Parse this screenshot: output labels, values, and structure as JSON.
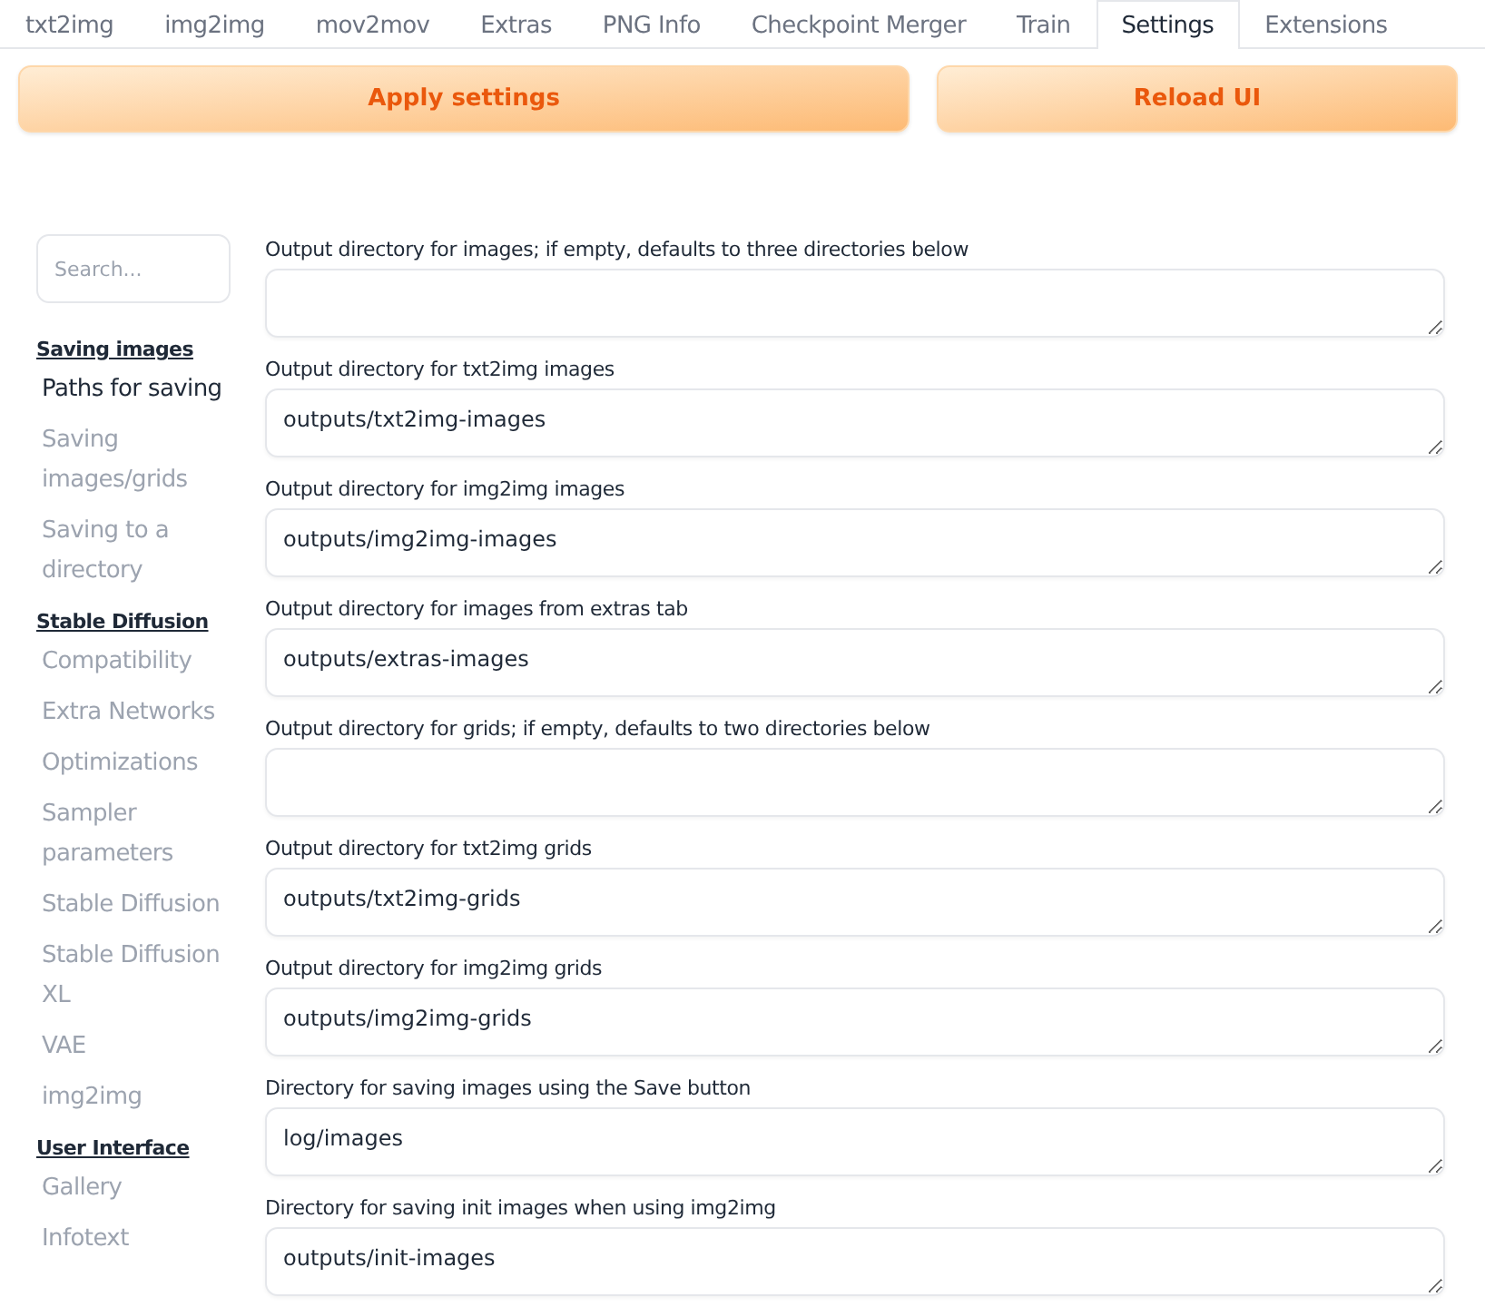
{
  "tabs": [
    {
      "label": "txt2img",
      "selected": false
    },
    {
      "label": "img2img",
      "selected": false
    },
    {
      "label": "mov2mov",
      "selected": false
    },
    {
      "label": "Extras",
      "selected": false
    },
    {
      "label": "PNG Info",
      "selected": false
    },
    {
      "label": "Checkpoint Merger",
      "selected": false
    },
    {
      "label": "Train",
      "selected": false
    },
    {
      "label": "Settings",
      "selected": true
    },
    {
      "label": "Extensions",
      "selected": false
    }
  ],
  "buttons": [
    "Apply settings",
    "Reload UI"
  ],
  "search": {
    "placeholder": "Search..."
  },
  "sidebar": [
    {
      "heading": "Saving images",
      "items": [
        {
          "label": "Paths for saving",
          "selected": true
        },
        {
          "label": "Saving images/grids",
          "selected": false
        },
        {
          "label": "Saving to a directory",
          "selected": false
        }
      ]
    },
    {
      "heading": "Stable Diffusion",
      "items": [
        {
          "label": "Compatibility",
          "selected": false
        },
        {
          "label": "Extra Networks",
          "selected": false
        },
        {
          "label": "Optimizations",
          "selected": false
        },
        {
          "label": "Sampler parameters",
          "selected": false
        },
        {
          "label": "Stable Diffusion",
          "selected": false
        },
        {
          "label": "Stable Diffusion XL",
          "selected": false
        },
        {
          "label": "VAE",
          "selected": false
        },
        {
          "label": "img2img",
          "selected": false
        }
      ]
    },
    {
      "heading": "User Interface",
      "items": [
        {
          "label": "Gallery",
          "selected": false
        },
        {
          "label": "Infotext",
          "selected": false
        }
      ]
    }
  ],
  "settings": [
    {
      "label": "Output directory for images; if empty, defaults to three directories below"
    },
    {
      "label": "Output directory for txt2img images",
      "value": "outputs/txt2img-images"
    },
    {
      "label": "Output directory for img2img images",
      "value": "outputs/img2img-images"
    },
    {
      "label": "Output directory for images from extras tab",
      "value": "outputs/extras-images"
    },
    {
      "label": "Output directory for grids; if empty, defaults to two directories below"
    },
    {
      "label": "Output directory for txt2img grids",
      "value": "outputs/txt2img-grids"
    },
    {
      "label": "Output directory for img2img grids",
      "value": "outputs/img2img-grids"
    },
    {
      "label": "Directory for saving images using the Save button",
      "value": "log/images"
    },
    {
      "label": "Directory for saving init images when using img2img",
      "value": "outputs/init-images"
    }
  ]
}
